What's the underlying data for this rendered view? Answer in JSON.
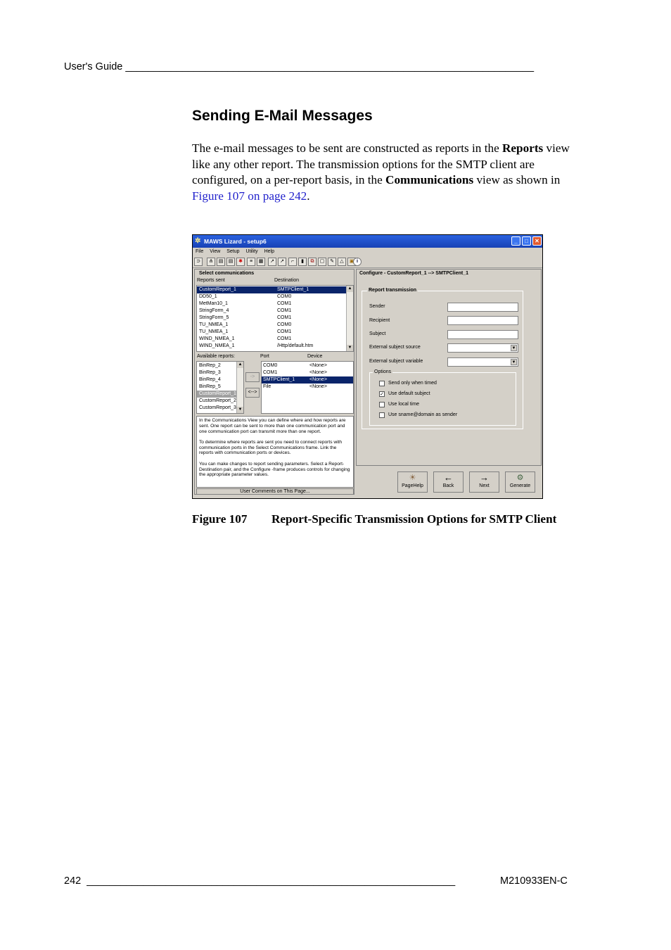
{
  "header": {
    "left": "User's Guide ________________________________________________________________________"
  },
  "footer": {
    "page": "242",
    "line": "_________________________________________________________________",
    "doc": "M210933EN-C"
  },
  "section": {
    "title": "Sending E-Mail Messages"
  },
  "paragraph": {
    "p1": "The e-mail messages to be sent are constructed as reports in the ",
    "b1": "Reports",
    "p2": " view like any other report. The transmission options for the SMTP client are configured, on a per-report basis, in the ",
    "b2": "Communications",
    "p3": " view as shown in ",
    "link": "Figure 107 on page 242",
    "p4": "."
  },
  "caption": {
    "number": "Figure 107",
    "text": "Report-Specific Transmission Options for SMTP Client"
  },
  "app": {
    "title": "MAWS Lizard - setup6",
    "menu": [
      "File",
      "View",
      "Setup",
      "Utility",
      "Help"
    ],
    "toolbar_icons": [
      "disconnect-icon",
      "tree-icon",
      "dev-icon",
      "dev2-icon",
      "star-icon",
      "ip-icon",
      "list-icon",
      "run-icon",
      "walk-icon",
      "flag-icon",
      "log-icon",
      "car-icon",
      "doc-icon",
      "edit-icon",
      "bell-icon",
      "chip-icon",
      "info-icon"
    ],
    "left": {
      "frame_title": "Select communications",
      "col_reports": "Reports sent",
      "col_dest": "Destination",
      "sent": [
        [
          "CustomReport_1",
          "SMTPClient_1"
        ],
        [
          "DD50_1",
          "COM0"
        ],
        [
          "MetMan10_1",
          "COM1"
        ],
        [
          "StringForm_4",
          "COM1"
        ],
        [
          "StringForm_5",
          "COM1"
        ],
        [
          "TU_NMEA_1",
          "COM0"
        ],
        [
          "TU_NMEA_1",
          "COM1"
        ],
        [
          "WIND_NMEA_1",
          "COM1"
        ],
        [
          "WIND_NMEA_1",
          "/Http/default.htm"
        ]
      ],
      "avail_label": "Available reports:",
      "port_label": "Port",
      "device_label": "Device",
      "available": [
        "BinRep_2",
        "BinRep_3",
        "BinRep_4",
        "BinRep_5",
        "CustomReport_1",
        "CustomReport_2",
        "CustomReport_3"
      ],
      "btn_add": "->",
      "btn_swap": "<-->",
      "ports": [
        [
          "COM0",
          "<None>"
        ],
        [
          "COM1",
          "<None>"
        ],
        [
          "SMTPClient_1",
          "<None>"
        ],
        [
          "File",
          "<None>"
        ]
      ],
      "help_p1": "In the Communications View you can define where and how reports are sent. One report can be sent to more than one communication port and one communication port can transmit more than one report.",
      "help_p2": "To determine where reports are sent you need to connect reports with communication ports in the Select Communications frame. Link the reports with communication ports or devices.",
      "help_p3": "You can make changes to report sending parameters. Select a Report-Destination pair, and the Configure -frame produces controls for changing the appropriate parameter values.",
      "comments_btn": "User Comments on This Page..."
    },
    "right": {
      "frame_title": "Configure - CustomReport_1 --> SMTPClient_1",
      "group_title": "Report transmission",
      "fields": [
        "Sender",
        "Recipient",
        "Subject",
        "External subject source",
        "External subject variable"
      ],
      "options_title": "Options",
      "options": [
        {
          "label": "Send only when timed",
          "checked": false
        },
        {
          "label": "Use default subject",
          "checked": true
        },
        {
          "label": "Use local time",
          "checked": false
        },
        {
          "label": "Use sname@domain as sender",
          "checked": false
        }
      ],
      "buttons": [
        "PageHelp",
        "Back",
        "Next",
        "Generate"
      ]
    }
  }
}
